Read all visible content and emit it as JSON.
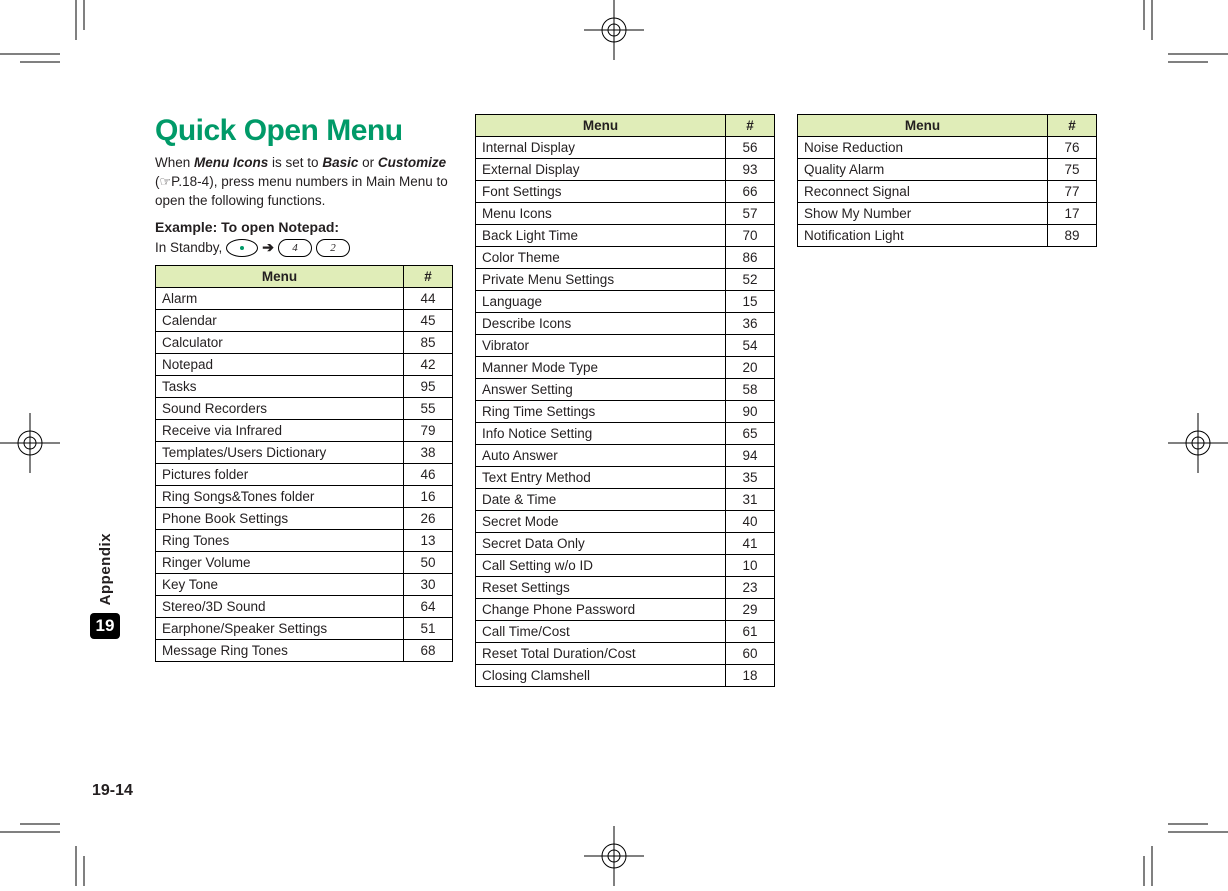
{
  "title": "Quick Open Menu",
  "intro": {
    "line1_prefix": "When ",
    "line1_bold1": "Menu Icons",
    "line1_mid": " is set to ",
    "line1_bold2": "Basic",
    "line1_or": " or ",
    "line1_bold3": "Customize",
    "line2_paren_open": "(",
    "line2_ref": "P.18-4",
    "line2_rest": "), press menu numbers in Main Menu to open the following functions."
  },
  "example_label": "Example: To open Notepad:",
  "standby": {
    "prefix": "In Standby, ",
    "key1": "4",
    "key2": "2",
    "arrow": "➔"
  },
  "side": {
    "appendix": "Appendix",
    "chapter": "19"
  },
  "footer": "19-14",
  "table_headers": {
    "menu": "Menu",
    "num": "#"
  },
  "tables": [
    {
      "rows": [
        {
          "menu": "Alarm",
          "num": "44"
        },
        {
          "menu": "Calendar",
          "num": "45"
        },
        {
          "menu": "Calculator",
          "num": "85"
        },
        {
          "menu": "Notepad",
          "num": "42"
        },
        {
          "menu": "Tasks",
          "num": "95"
        },
        {
          "menu": "Sound Recorders",
          "num": "55"
        },
        {
          "menu": "Receive via Infrared",
          "num": "79"
        },
        {
          "menu": "Templates/Users Dictionary",
          "num": "38"
        },
        {
          "menu": "Pictures folder",
          "num": "46"
        },
        {
          "menu": "Ring Songs&Tones folder",
          "num": "16"
        },
        {
          "menu": "Phone Book Settings",
          "num": "26"
        },
        {
          "menu": "Ring Tones",
          "num": "13"
        },
        {
          "menu": "Ringer Volume",
          "num": "50"
        },
        {
          "menu": "Key Tone",
          "num": "30"
        },
        {
          "menu": "Stereo/3D Sound",
          "num": "64"
        },
        {
          "menu": "Earphone/Speaker Settings",
          "num": "51"
        },
        {
          "menu": "Message Ring Tones",
          "num": "68"
        }
      ]
    },
    {
      "rows": [
        {
          "menu": "Internal Display",
          "num": "56"
        },
        {
          "menu": "External Display",
          "num": "93"
        },
        {
          "menu": "Font Settings",
          "num": "66"
        },
        {
          "menu": "Menu Icons",
          "num": "57"
        },
        {
          "menu": "Back Light Time",
          "num": "70"
        },
        {
          "menu": "Color Theme",
          "num": "86"
        },
        {
          "menu": "Private Menu Settings",
          "num": "52"
        },
        {
          "menu": "Language",
          "num": "15"
        },
        {
          "menu": "Describe Icons",
          "num": "36"
        },
        {
          "menu": "Vibrator",
          "num": "54"
        },
        {
          "menu": "Manner Mode Type",
          "num": "20"
        },
        {
          "menu": "Answer Setting",
          "num": "58"
        },
        {
          "menu": "Ring Time Settings",
          "num": "90"
        },
        {
          "menu": "Info Notice Setting",
          "num": "65"
        },
        {
          "menu": "Auto Answer",
          "num": "94"
        },
        {
          "menu": "Text Entry Method",
          "num": "35"
        },
        {
          "menu": "Date & Time",
          "num": "31"
        },
        {
          "menu": "Secret Mode",
          "num": "40"
        },
        {
          "menu": "Secret Data Only",
          "num": "41"
        },
        {
          "menu": "Call Setting w/o ID",
          "num": "10"
        },
        {
          "menu": "Reset Settings",
          "num": "23"
        },
        {
          "menu": "Change Phone Password",
          "num": "29"
        },
        {
          "menu": "Call Time/Cost",
          "num": "61"
        },
        {
          "menu": "Reset Total Duration/Cost",
          "num": "60"
        },
        {
          "menu": "Closing Clamshell",
          "num": "18"
        }
      ]
    },
    {
      "rows": [
        {
          "menu": "Noise Reduction",
          "num": "76"
        },
        {
          "menu": "Quality Alarm",
          "num": "75"
        },
        {
          "menu": "Reconnect Signal",
          "num": "77"
        },
        {
          "menu": "Show My Number",
          "num": "17"
        },
        {
          "menu": "Notification Light",
          "num": "89"
        }
      ]
    }
  ]
}
